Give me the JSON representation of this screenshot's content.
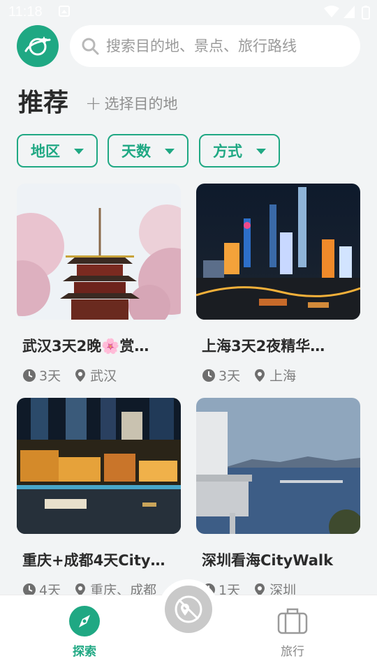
{
  "status_bar": {
    "time": "11:18"
  },
  "header": {
    "logo_icon": "planet-icon",
    "search_placeholder": "搜索目的地、景点、旅行路线"
  },
  "section": {
    "title": "推荐",
    "choose_destination": "选择目的地"
  },
  "filters": [
    {
      "label": "地区"
    },
    {
      "label": "天数"
    },
    {
      "label": "方式"
    }
  ],
  "cards": [
    {
      "title": "武汉3天2晚🌸赏…",
      "days": "3天",
      "location": "武汉"
    },
    {
      "title": "上海3天2夜精华…",
      "days": "3天",
      "location": "上海"
    },
    {
      "title": "重庆+成都4天City…",
      "days": "4天",
      "location": "重庆、成都"
    },
    {
      "title": "深圳看海CityWalk",
      "days": "1天",
      "location": "深圳"
    }
  ],
  "bottom_nav": {
    "explore": "探索",
    "travel": "旅行"
  },
  "colors": {
    "accent": "#1fa883",
    "background": "#f2f4f5"
  }
}
